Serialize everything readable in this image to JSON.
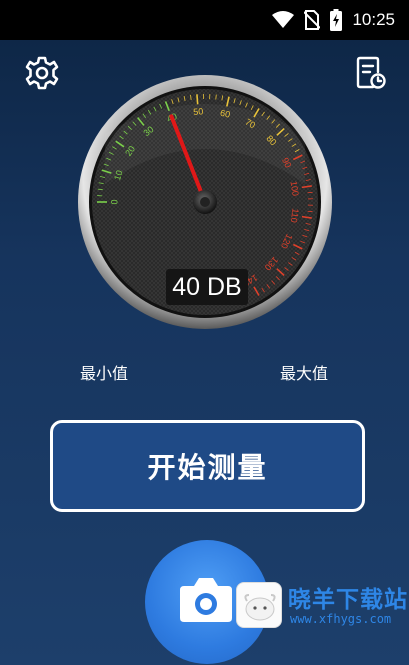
{
  "status_bar": {
    "time": "10:25",
    "icons": [
      "wifi-icon",
      "no-sim-icon",
      "battery-charging-icon"
    ]
  },
  "toolbar": {
    "left_icon": "gear-icon",
    "right_icon": "history-document-icon"
  },
  "gauge": {
    "value": 40,
    "min": 0,
    "max": 140,
    "tick_labels": [
      "0",
      "10",
      "20",
      "30",
      "40",
      "50",
      "60",
      "70",
      "80",
      "90",
      "100",
      "110",
      "120",
      "130",
      "140"
    ],
    "readout": "40 DB",
    "colors": {
      "low": "#7bd04a",
      "mid": "#e8c23a",
      "high": "#e0402a",
      "needle": "#e01818"
    }
  },
  "labels": {
    "min": "最小值",
    "max": "最大值"
  },
  "start_button": {
    "label": "开始测量"
  },
  "bottom_button": {
    "icon": "camera-icon"
  },
  "watermark": {
    "title": "晓羊下载站",
    "url": "www.xfhygs.com",
    "icon": "sheep-logo-icon"
  }
}
